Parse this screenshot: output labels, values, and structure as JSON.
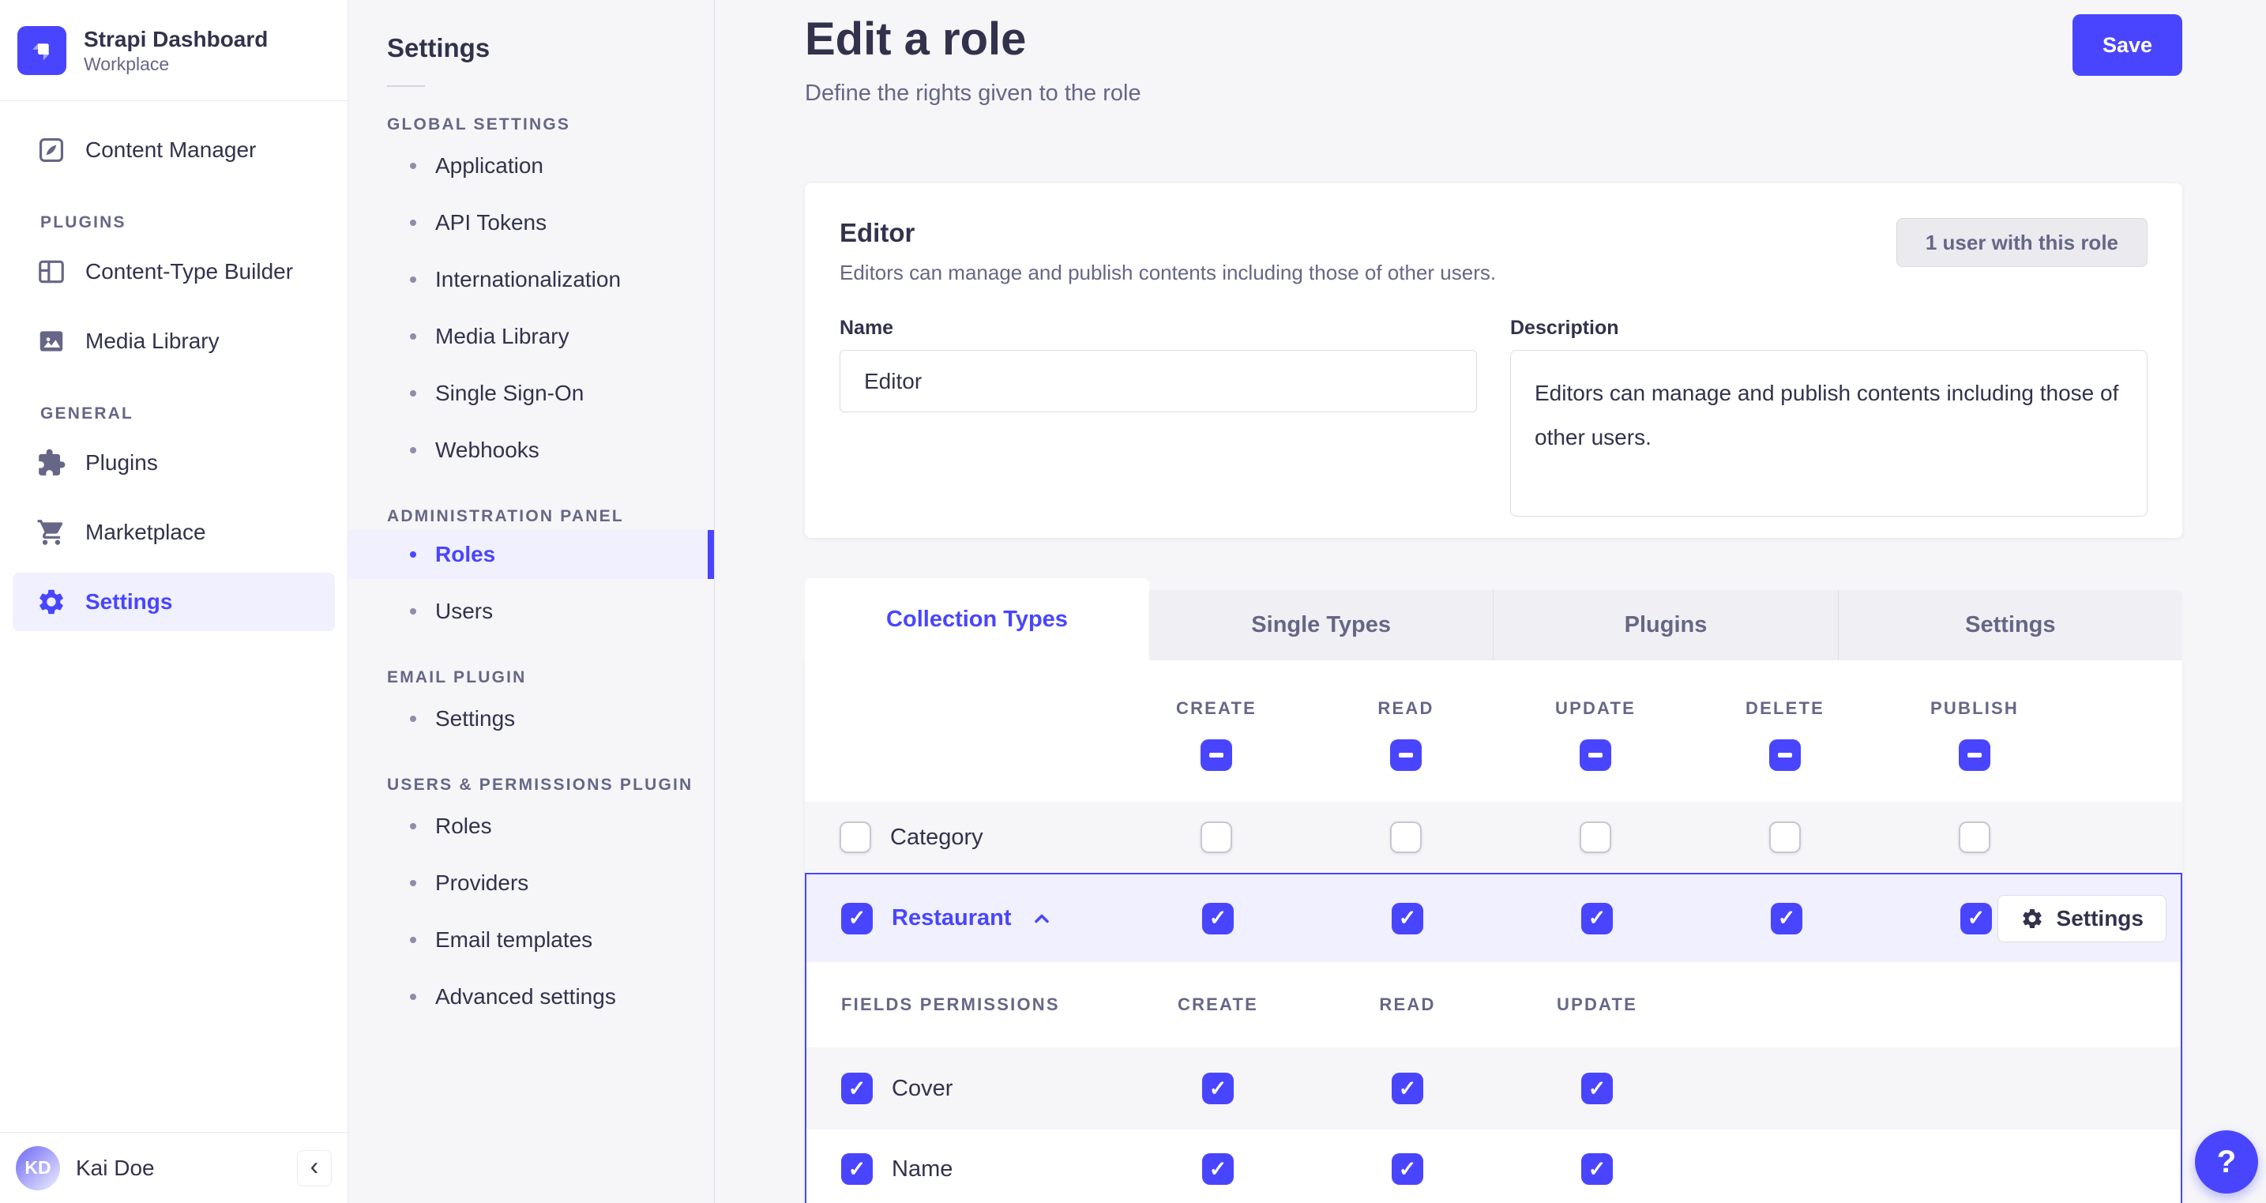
{
  "colors": {
    "accent": "#4945ff",
    "accent_bg": "#f0f0ff",
    "page_bg": "#f6f6f9",
    "text_dark": "#32324d",
    "text_gray": "#666687"
  },
  "brand": {
    "title": "Strapi Dashboard",
    "subtitle": "Workplace"
  },
  "main_nav": {
    "content_manager": "Content Manager",
    "sections": [
      {
        "label": "PLUGINS",
        "items": [
          "Content-Type Builder",
          "Media Library"
        ]
      },
      {
        "label": "GENERAL",
        "items": [
          "Plugins",
          "Marketplace",
          "Settings"
        ]
      }
    ],
    "active_item": "Settings",
    "user": {
      "initials": "KD",
      "name": "Kai Doe",
      "collapse_icon": "‹"
    }
  },
  "subnav": {
    "title": "Settings",
    "sections": [
      {
        "label": "GLOBAL SETTINGS",
        "items": [
          "Application",
          "API Tokens",
          "Internationalization",
          "Media Library",
          "Single Sign-On",
          "Webhooks"
        ]
      },
      {
        "label": "ADMINISTRATION PANEL",
        "items": [
          "Roles",
          "Users"
        ]
      },
      {
        "label": "EMAIL PLUGIN",
        "items": [
          "Settings"
        ]
      },
      {
        "label": "USERS & PERMISSIONS PLUGIN",
        "items": [
          "Roles",
          "Providers",
          "Email templates",
          "Advanced settings"
        ]
      }
    ],
    "active_item": "Roles"
  },
  "header": {
    "title": "Edit a role",
    "subtitle": "Define the rights given to the role",
    "save_label": "Save"
  },
  "role_card": {
    "title": "Editor",
    "description": "Editors can manage and publish contents including those of other users.",
    "users_badge": "1 user with this role",
    "name_field": {
      "label": "Name",
      "value": "Editor"
    },
    "description_field": {
      "label": "Description",
      "value": "Editors can manage and publish contents including those of other users."
    }
  },
  "permissions": {
    "tabs": [
      "Collection Types",
      "Single Types",
      "Plugins",
      "Settings"
    ],
    "active_tab": "Collection Types",
    "columns": [
      "CREATE",
      "READ",
      "UPDATE",
      "DELETE",
      "PUBLISH"
    ],
    "header_checkbox_state": "indeterminate",
    "rows": [
      {
        "label": "Category",
        "row_checked": false,
        "cells": [
          false,
          false,
          false,
          false,
          false
        ]
      },
      {
        "label": "Restaurant",
        "row_checked": true,
        "expanded": true,
        "cells": [
          true,
          true,
          true,
          true,
          true
        ],
        "settings_button": "Settings"
      }
    ],
    "fields": {
      "header": "FIELDS PERMISSIONS",
      "columns": [
        "CREATE",
        "READ",
        "UPDATE"
      ],
      "rows": [
        {
          "label": "Cover",
          "row_checked": true,
          "cells": [
            true,
            true,
            true
          ]
        },
        {
          "label": "Name",
          "row_checked": true,
          "cells": [
            true,
            true,
            true
          ]
        }
      ]
    }
  },
  "help": {
    "label": "?"
  }
}
